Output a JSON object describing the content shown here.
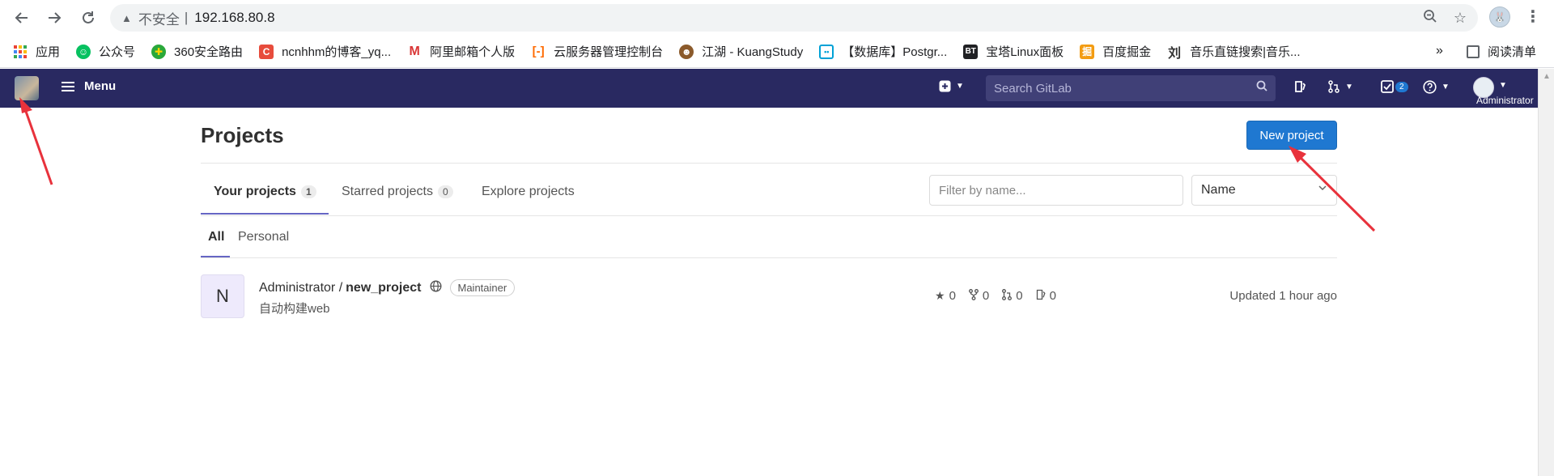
{
  "browser": {
    "back_icon": "arrow-left-icon",
    "forward_icon": "arrow-right-icon",
    "reload_icon": "reload-icon",
    "security_label": "不安全",
    "separator": "|",
    "url": "192.168.80.8",
    "bookmarks": [
      {
        "label": "应用",
        "icon": "apps-grid-icon",
        "color": "#ea4335"
      },
      {
        "label": "公众号",
        "icon": "wechat-icon",
        "color": "#07c160"
      },
      {
        "label": "360安全路由",
        "icon": "360-icon",
        "color": "#2aa83a"
      },
      {
        "label": "ncnhhm的博客_yq...",
        "icon": "csdn-icon",
        "color": "#e74c3c"
      },
      {
        "label": "阿里邮箱个人版",
        "icon": "aliyun-mail-icon",
        "color": "#d93636"
      },
      {
        "label": "云服务器管理控制台",
        "icon": "aliyun-icon",
        "color": "#ff6a00"
      },
      {
        "label": "江湖 - KuangStudy",
        "icon": "kuangstudy-icon",
        "color": "#8b5a2b"
      },
      {
        "label": "【数据库】Postgr...",
        "icon": "bilibili-icon",
        "color": "#00a1d6"
      },
      {
        "label": "宝塔Linux面板",
        "icon": "bt-icon",
        "color": "#20a53a"
      },
      {
        "label": "百度掘金",
        "icon": "juejin-icon",
        "color": "#f39c12"
      },
      {
        "label": "音乐直链搜索|音乐...",
        "icon": "music-icon",
        "color": "#333333"
      }
    ],
    "more_label": "»",
    "reading_list_label": "阅读清单"
  },
  "gitlab_nav": {
    "menu_label": "Menu",
    "search_placeholder": "Search GitLab",
    "todo_count": "2",
    "user_label": "Administrator"
  },
  "page": {
    "title": "Projects",
    "new_project_label": "New project",
    "tabs": [
      {
        "label": "Your projects",
        "count": "1"
      },
      {
        "label": "Starred projects",
        "count": "0"
      },
      {
        "label": "Explore projects"
      }
    ],
    "filter_placeholder": "Filter by name...",
    "sort_value": "Name",
    "subtabs": [
      "All",
      "Personal"
    ],
    "project": {
      "avatar_letter": "N",
      "namespace": "Administrator /",
      "name": "new_project",
      "role": "Maintainer",
      "description": "自动构建web",
      "stars": "0",
      "forks": "0",
      "merge_requests": "0",
      "issues": "0",
      "updated": "Updated 1 hour ago"
    }
  },
  "colors": {
    "navbar": "#292961",
    "primary_button": "#1f78d1",
    "annotation_arrow": "#e8323c",
    "tab_underline": "#6666c4"
  }
}
